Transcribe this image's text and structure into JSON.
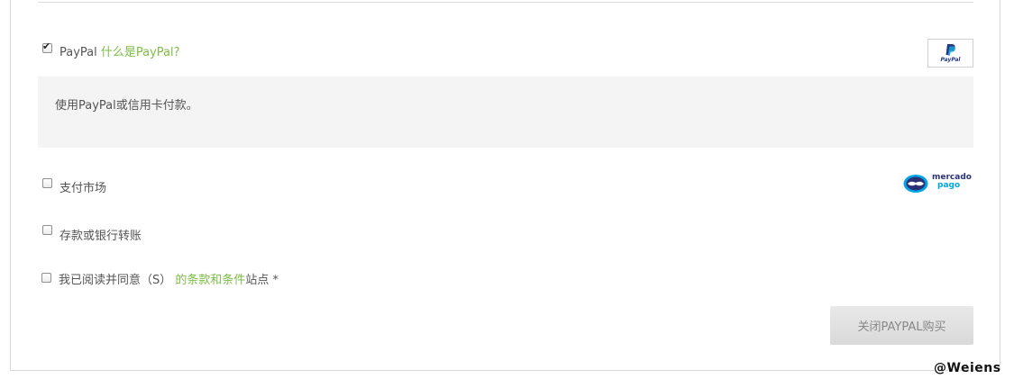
{
  "payment": {
    "paypal": {
      "checked": true,
      "label": "PayPal",
      "what_is_link": "什么是PayPal?",
      "logo_text": "PayPal",
      "description": "使用PayPal或信用卡付款。"
    },
    "mercado": {
      "checked": false,
      "label": "支付市场",
      "logo_line1": "mercado",
      "logo_line2": "pago"
    },
    "bank_transfer": {
      "checked": false,
      "label": "存款或银行转账"
    }
  },
  "terms": {
    "checked": false,
    "prefix": "我已阅读并同意（S）",
    "link": "的条款和条件",
    "suffix": "站点 *"
  },
  "actions": {
    "close_paypal_button": "关闭PAYPAL购买"
  },
  "watermark": "@Weiens",
  "colors": {
    "link_green": "#7dbd44",
    "paypal_navy": "#253b80",
    "paypal_blue": "#179bd7",
    "mercado_blue": "#00a6e3",
    "mercado_navy": "#2d3277",
    "desc_bg": "#f4f4f4",
    "button_bg": "#e0e0e0"
  }
}
